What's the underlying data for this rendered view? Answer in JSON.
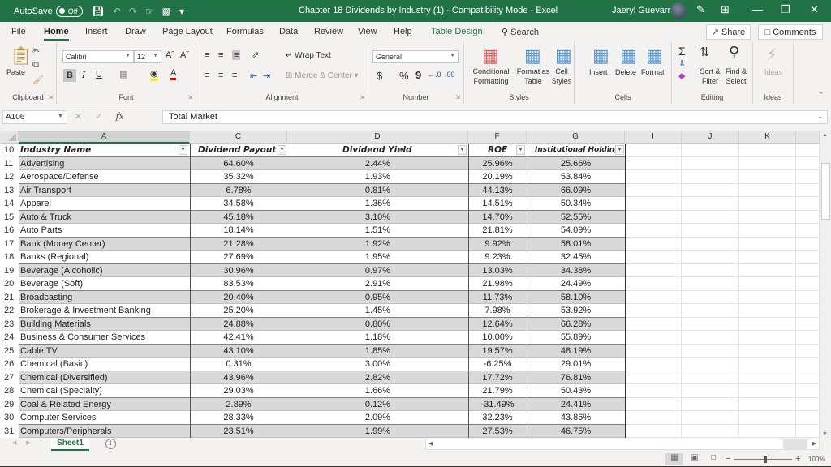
{
  "titlebar": {
    "autosave_label": "AutoSave",
    "autosave_state": "Off",
    "title": "Chapter 18 Dividends by Industry (1)  -  Compatibility Mode  -  Excel",
    "user_name": "Jaeryl Guevarra"
  },
  "menu": {
    "items": [
      "File",
      "Home",
      "Insert",
      "Draw",
      "Page Layout",
      "Formulas",
      "Data",
      "Review",
      "View",
      "Help",
      "Table Design"
    ],
    "active": "Home",
    "search_label": "Search",
    "share_label": "Share",
    "comments_label": "Comments"
  },
  "ribbon": {
    "clipboard": {
      "paste": "Paste",
      "group": "Clipboard"
    },
    "font": {
      "name": "Calibri",
      "size": "12",
      "group": "Font",
      "bold": "B",
      "italic": "I",
      "underline": "U"
    },
    "alignment": {
      "wrap_text": "Wrap Text",
      "merge_center": "Merge & Center",
      "group": "Alignment"
    },
    "number": {
      "format": "General",
      "group": "Number",
      "currency": "$",
      "percent": "%",
      "comma": "9"
    },
    "styles": {
      "conditional": [
        "Conditional",
        "Formatting"
      ],
      "format_table": [
        "Format as",
        "Table"
      ],
      "cell_styles": [
        "Cell",
        "Styles"
      ],
      "group": "Styles"
    },
    "cells": {
      "insert": "Insert",
      "delete": "Delete",
      "format": "Format",
      "group": "Cells"
    },
    "editing": {
      "sort": [
        "Sort &",
        "Filter"
      ],
      "find": [
        "Find &",
        "Select"
      ],
      "group": "Editing"
    },
    "ideas": {
      "label": "Ideas",
      "group": "Ideas"
    }
  },
  "formula_bar": {
    "name_box": "A106",
    "fx": "fx",
    "value": "Total Market"
  },
  "sheet": {
    "columns": [
      "A",
      "C",
      "D",
      "F",
      "G",
      "I",
      "J",
      "K"
    ],
    "header_row": "10",
    "headers": [
      "Industry Name",
      "Dividend Payout",
      "Dividend Yield",
      "ROE",
      "Institutional Holdings"
    ],
    "rows": [
      {
        "n": "11",
        "name": "Advertising",
        "payout": "64.60%",
        "yield": "2.44%",
        "roe": "25.96%",
        "inst": "25.66%"
      },
      {
        "n": "12",
        "name": "Aerospace/Defense",
        "payout": "35.32%",
        "yield": "1.93%",
        "roe": "20.19%",
        "inst": "53.84%"
      },
      {
        "n": "13",
        "name": "Air Transport",
        "payout": "6.78%",
        "yield": "0.81%",
        "roe": "44.13%",
        "inst": "66.09%"
      },
      {
        "n": "14",
        "name": "Apparel",
        "payout": "34.58%",
        "yield": "1.36%",
        "roe": "14.51%",
        "inst": "50.34%"
      },
      {
        "n": "15",
        "name": "Auto & Truck",
        "payout": "45.18%",
        "yield": "3.10%",
        "roe": "14.70%",
        "inst": "52.55%"
      },
      {
        "n": "16",
        "name": "Auto Parts",
        "payout": "18.14%",
        "yield": "1.51%",
        "roe": "21.81%",
        "inst": "54.09%"
      },
      {
        "n": "17",
        "name": "Bank (Money Center)",
        "payout": "21.28%",
        "yield": "1.92%",
        "roe": "9.92%",
        "inst": "58.01%"
      },
      {
        "n": "18",
        "name": "Banks (Regional)",
        "payout": "27.69%",
        "yield": "1.95%",
        "roe": "9.23%",
        "inst": "32.45%"
      },
      {
        "n": "19",
        "name": "Beverage (Alcoholic)",
        "payout": "30.96%",
        "yield": "0.97%",
        "roe": "13.03%",
        "inst": "34.38%"
      },
      {
        "n": "20",
        "name": "Beverage (Soft)",
        "payout": "83.53%",
        "yield": "2.91%",
        "roe": "21.98%",
        "inst": "24.49%"
      },
      {
        "n": "21",
        "name": "Broadcasting",
        "payout": "20.40%",
        "yield": "0.95%",
        "roe": "11.73%",
        "inst": "58.10%"
      },
      {
        "n": "22",
        "name": "Brokerage & Investment Banking",
        "payout": "25.20%",
        "yield": "1.45%",
        "roe": "7.98%",
        "inst": "53.92%"
      },
      {
        "n": "23",
        "name": "Building Materials",
        "payout": "24.88%",
        "yield": "0.80%",
        "roe": "12.64%",
        "inst": "66.28%"
      },
      {
        "n": "24",
        "name": "Business & Consumer Services",
        "payout": "42.41%",
        "yield": "1.18%",
        "roe": "10.00%",
        "inst": "55.89%"
      },
      {
        "n": "25",
        "name": "Cable TV",
        "payout": "43.10%",
        "yield": "1.85%",
        "roe": "19.57%",
        "inst": "48.19%"
      },
      {
        "n": "26",
        "name": "Chemical (Basic)",
        "payout": "0.31%",
        "yield": "3.00%",
        "roe": "-6.25%",
        "inst": "29.01%"
      },
      {
        "n": "27",
        "name": "Chemical (Diversified)",
        "payout": "43.96%",
        "yield": "2.82%",
        "roe": "17.72%",
        "inst": "76.81%"
      },
      {
        "n": "28",
        "name": "Chemical (Specialty)",
        "payout": "29.03%",
        "yield": "1.66%",
        "roe": "21.79%",
        "inst": "50.43%"
      },
      {
        "n": "29",
        "name": "Coal & Related Energy",
        "payout": "2.89%",
        "yield": "0.12%",
        "roe": "-31.49%",
        "inst": "24.41%"
      },
      {
        "n": "30",
        "name": "Computer Services",
        "payout": "28.33%",
        "yield": "2.09%",
        "roe": "32.23%",
        "inst": "43.86%"
      },
      {
        "n": "31",
        "name": "Computers/Peripherals",
        "payout": "23.51%",
        "yield": "1.99%",
        "roe": "27.53%",
        "inst": "46.75%"
      }
    ]
  },
  "tabs": {
    "active_sheet": "Sheet1"
  },
  "statusbar": {
    "zoom": "100%"
  },
  "colors": {
    "brand": "#217346",
    "band": "#d9d9d9"
  }
}
